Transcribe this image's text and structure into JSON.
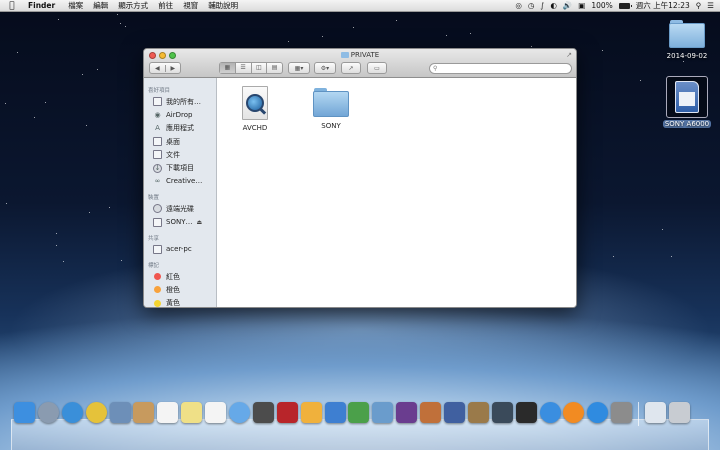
{
  "menubar": {
    "apple_icon": "apple-icon",
    "app_name": "Finder",
    "menus": [
      "檔案",
      "編輯",
      "顯示方式",
      "前往",
      "視窗",
      "輔助說明"
    ],
    "battery_percent": "100%",
    "battery_level": 1.0,
    "clock": "週六 上午12:23"
  },
  "desktop": {
    "folder_label": "2014-09-02",
    "drive_label": "SONY A6000"
  },
  "window": {
    "title": "PRIVATE",
    "search_placeholder": "",
    "sidebar": {
      "sections": [
        {
          "heading": "喜好項目",
          "items": [
            {
              "label": "我的所有…",
              "icon": "all-files-icon"
            },
            {
              "label": "AirDrop",
              "icon": "airdrop-icon"
            },
            {
              "label": "應用程式",
              "icon": "applications-icon"
            },
            {
              "label": "桌面",
              "icon": "desktop-icon"
            },
            {
              "label": "文件",
              "icon": "documents-icon"
            },
            {
              "label": "下載項目",
              "icon": "downloads-icon"
            },
            {
              "label": "Creative…",
              "icon": "creative-cloud-icon"
            }
          ]
        },
        {
          "heading": "裝置",
          "items": [
            {
              "label": "遠端光碟",
              "icon": "remote-disc-icon"
            },
            {
              "label": "SONY…",
              "icon": "drive-icon"
            }
          ]
        },
        {
          "heading": "共享",
          "items": [
            {
              "label": "acer-pc",
              "icon": "pc-icon"
            }
          ]
        },
        {
          "heading": "標記",
          "items": [
            {
              "label": "紅色",
              "icon": "tag-red-icon",
              "color": "#f0564f"
            },
            {
              "label": "橙色",
              "icon": "tag-orange-icon",
              "color": "#f8a23c"
            },
            {
              "label": "黃色",
              "icon": "tag-yellow-icon",
              "color": "#f5d531"
            }
          ]
        }
      ]
    },
    "files": [
      {
        "name": "AVCHD",
        "icon": "quicktime-document-icon"
      },
      {
        "name": "SONY",
        "icon": "folder-icon"
      }
    ]
  },
  "dock": {
    "apps": [
      {
        "name": "finder-icon",
        "color": "#3d8fe0"
      },
      {
        "name": "launchpad-icon",
        "color": "#8a9bb0"
      },
      {
        "name": "safari-icon",
        "color": "#3a8fd9"
      },
      {
        "name": "chrome-icon",
        "color": "#e5c23a"
      },
      {
        "name": "preview-icon",
        "color": "#6d8fb8"
      },
      {
        "name": "contacts-icon",
        "color": "#c79a5e"
      },
      {
        "name": "calendar-icon",
        "color": "#f4f4f4"
      },
      {
        "name": "notes-icon",
        "color": "#efe087"
      },
      {
        "name": "reminders-icon",
        "color": "#f4f4f4"
      },
      {
        "name": "messages-icon",
        "color": "#66a9e8"
      },
      {
        "name": "facetime-icon",
        "color": "#4c4c4c"
      },
      {
        "name": "photo-booth-icon",
        "color": "#b8252a"
      },
      {
        "name": "pages-icon",
        "color": "#f0b13c"
      },
      {
        "name": "keynote-icon",
        "color": "#3e7fd1"
      },
      {
        "name": "numbers-icon",
        "color": "#4ba04a"
      },
      {
        "name": "iphoto-icon",
        "color": "#6a9ccc"
      },
      {
        "name": "imovie-icon",
        "color": "#6a3d8f"
      },
      {
        "name": "garageband-icon",
        "color": "#c0703a"
      },
      {
        "name": "iphoto-library-icon",
        "color": "#4060a0"
      },
      {
        "name": "image-capture-icon",
        "color": "#9a7a4a"
      },
      {
        "name": "raw-converter-icon",
        "color": "#3a4a5a"
      },
      {
        "name": "camera-icon",
        "color": "#2a2a2a"
      },
      {
        "name": "itunes-icon",
        "color": "#3a8ee0"
      },
      {
        "name": "ibooks-icon",
        "color": "#f28b22"
      },
      {
        "name": "app-store-icon",
        "color": "#2f8be0"
      },
      {
        "name": "system-preferences-icon",
        "color": "#8c8c8c"
      }
    ],
    "stacks": [
      {
        "name": "documents-stack-icon",
        "color": "#dfe6ee"
      },
      {
        "name": "trash-icon",
        "color": "#c8ccd2"
      }
    ]
  }
}
